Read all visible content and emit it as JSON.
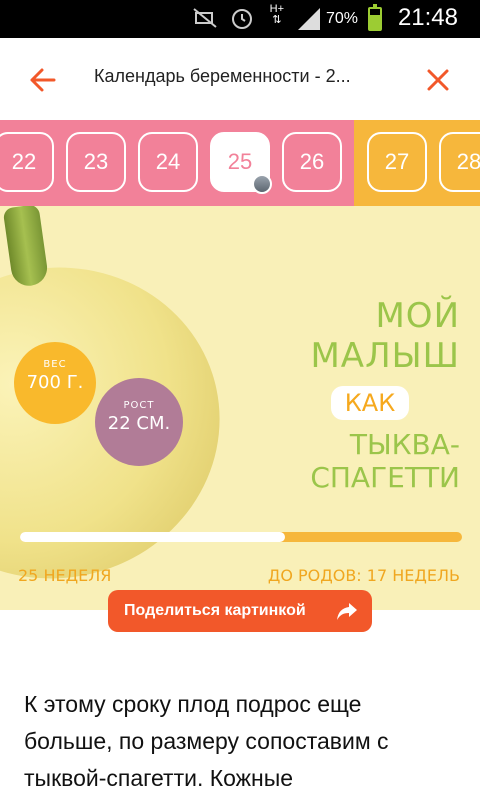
{
  "status_bar": {
    "time": "21:48",
    "battery_percent": "70%",
    "network_label_top": "H+",
    "network_label_bottom": "⇅"
  },
  "app_bar": {
    "title": "Календарь беременности - 2..."
  },
  "week_strip": {
    "weeks": [
      "22",
      "23",
      "24",
      "25",
      "26",
      "27",
      "28"
    ],
    "active_week": "25"
  },
  "hero": {
    "weight_label": "ВЕС",
    "weight_value": "700 Г.",
    "height_label": "РОСТ",
    "height_value": "22 СМ.",
    "headline_line1": "МОЙ МАЛЫШ",
    "headline_line2": "КАК",
    "headline_line3": "ТЫКВА-СПАГЕТТИ",
    "week_label": "25 НЕДЕЛЯ",
    "remaining_prefix": "ДО РОДОВ:",
    "remaining_value": "17 НЕДЕЛЬ",
    "progress_fraction": 0.6
  },
  "share_button": {
    "label": "Поделиться картинкой"
  },
  "article": {
    "text": "К этому сроку плод подрос еще больше, по размеру сопоставим с тыквой-спагетти. Кожные"
  },
  "colors": {
    "accent": "#f2582a",
    "pink": "#f28199",
    "yellow": "#f6b73c",
    "green_text": "#9bc54a"
  }
}
